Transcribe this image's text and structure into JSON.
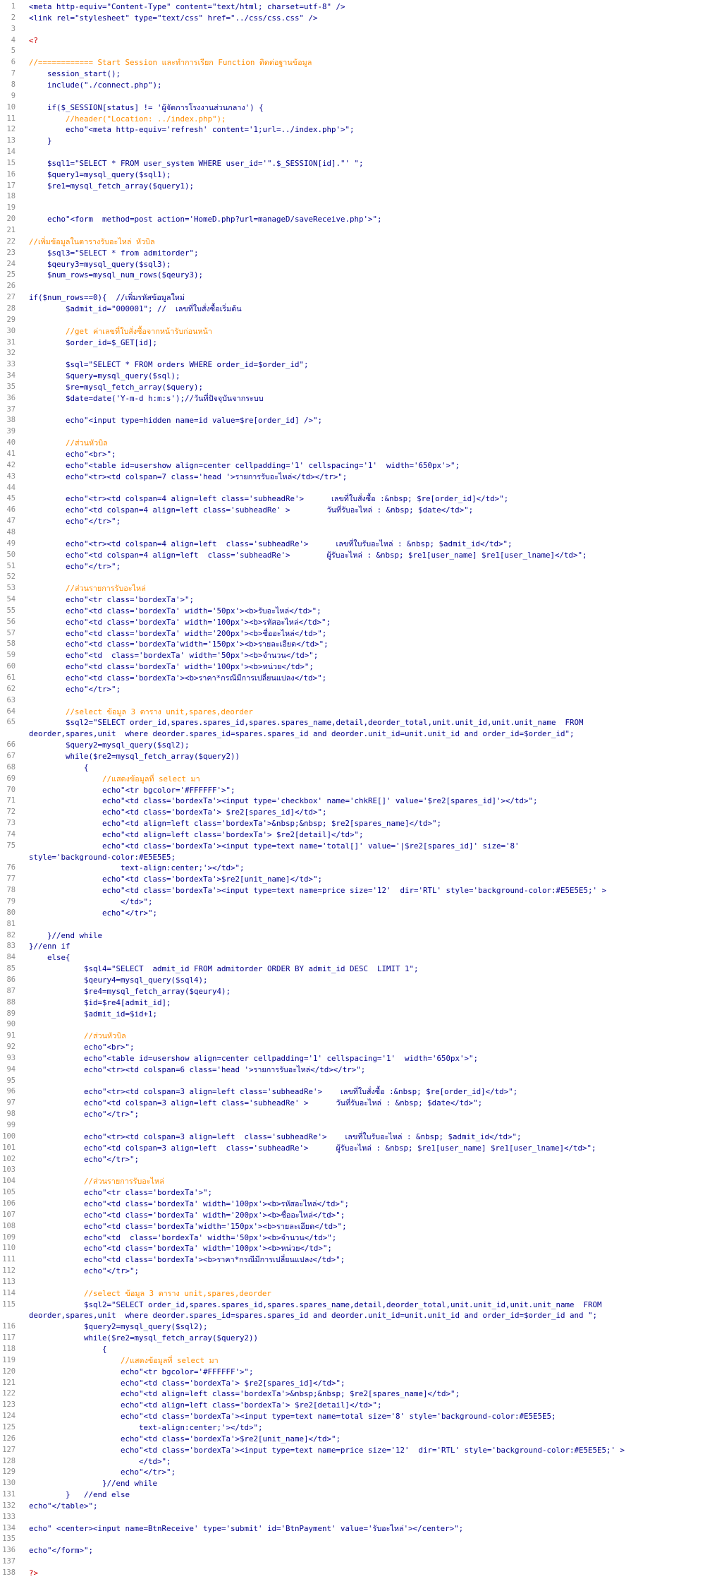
{
  "colors": {
    "keyword": "#00008b",
    "string": "#cc0000",
    "comment": "#ff8c00",
    "linenumber": "#8c8c8c"
  },
  "lines": [
    {
      "n": "1",
      "code": "<meta http-equiv=\"Content-Type\" content=\"text/html; charset=utf-8\" />",
      "type": "kw"
    },
    {
      "n": "2",
      "code": "<link rel=\"stylesheet\" type=\"text/css\" href=\"../css/css.css\" />",
      "type": "kw"
    },
    {
      "n": "3",
      "code": "",
      "type": "kw"
    },
    {
      "n": "4",
      "code": "<?",
      "type": "str"
    },
    {
      "n": "5",
      "code": "",
      "type": "kw"
    },
    {
      "n": "6",
      "code": "//============ Start Session และทำการเรียก Function ติดต่อฐานข้อมูล",
      "type": "cmt"
    },
    {
      "n": "7",
      "code": "    session_start();",
      "type": "kw"
    },
    {
      "n": "8",
      "code": "    include(\"./connect.php\");",
      "type": "kw"
    },
    {
      "n": "9",
      "code": "",
      "type": "kw"
    },
    {
      "n": "10",
      "code": "    if($_SESSION[status] != 'ผู้จัดการโรงงานส่วนกลาง') {",
      "type": "kw"
    },
    {
      "n": "11",
      "code": "        //header(\"Location: ../index.php\");",
      "type": "cmt"
    },
    {
      "n": "12",
      "code": "        echo\"<meta http-equiv='refresh' content='1;url=../index.php'>\";",
      "type": "kw"
    },
    {
      "n": "13",
      "code": "    }",
      "type": "kw"
    },
    {
      "n": "14",
      "code": "",
      "type": "kw"
    },
    {
      "n": "15",
      "code": "    $sql1=\"SELECT * FROM user_system WHERE user_id='\".$_SESSION[id].\"' \";",
      "type": "kw"
    },
    {
      "n": "16",
      "code": "    $query1=mysql_query($sql1);",
      "type": "kw"
    },
    {
      "n": "17",
      "code": "    $re1=mysql_fetch_array($query1);",
      "type": "kw"
    },
    {
      "n": "18",
      "code": "",
      "type": "kw"
    },
    {
      "n": "19",
      "code": "",
      "type": "kw"
    },
    {
      "n": "20",
      "code": "    echo\"<form  method=post action='HomeD.php?url=manageD/saveReceive.php'>\";",
      "type": "kw"
    },
    {
      "n": "21",
      "code": "",
      "type": "kw"
    },
    {
      "n": "22",
      "code": "//เพิ่มข้อมูลในตารางรับอะไหล่ หัวบิล",
      "type": "cmt"
    },
    {
      "n": "23",
      "code": "    $sql3=\"SELECT * from admitorder\";",
      "type": "kw"
    },
    {
      "n": "24",
      "code": "    $qeury3=mysql_query($sql3);",
      "type": "kw"
    },
    {
      "n": "25",
      "code": "    $num_rows=mysql_num_rows($qeury3);",
      "type": "kw"
    },
    {
      "n": "26",
      "code": "",
      "type": "kw"
    },
    {
      "n": "27",
      "code": "if($num_rows==0){  //เพิ่มรหัสข้อมูลใหม่",
      "type": "kw"
    },
    {
      "n": "28",
      "code": "        $admit_id=\"000001\"; //  เลขที่ใบสั่งซื้อเริ่มต้น",
      "type": "kw"
    },
    {
      "n": "29",
      "code": "",
      "type": "kw"
    },
    {
      "n": "30",
      "code": "        //get ค่าเลขที่ใบสั่งซื้อจากหน้ารับก่อนหน้า",
      "type": "cmt"
    },
    {
      "n": "31",
      "code": "        $order_id=$_GET[id];",
      "type": "kw"
    },
    {
      "n": "32",
      "code": "",
      "type": "kw"
    },
    {
      "n": "33",
      "code": "        $sql=\"SELECT * FROM orders WHERE order_id=$order_id\";",
      "type": "kw"
    },
    {
      "n": "34",
      "code": "        $query=mysql_query($sql);",
      "type": "kw"
    },
    {
      "n": "35",
      "code": "        $re=mysql_fetch_array($query);",
      "type": "kw"
    },
    {
      "n": "36",
      "code": "        $date=date('Y-m-d h:m:s');//วันที่ปัจจุบันจากระบบ",
      "type": "kw"
    },
    {
      "n": "37",
      "code": "",
      "type": "kw"
    },
    {
      "n": "38",
      "code": "        echo\"<input type=hidden name=id value=$re[order_id] />\";",
      "type": "kw"
    },
    {
      "n": "39",
      "code": "",
      "type": "kw"
    },
    {
      "n": "40",
      "code": "        //ส่วนหัวบิล",
      "type": "cmt"
    },
    {
      "n": "41",
      "code": "        echo\"<br>\";",
      "type": "kw"
    },
    {
      "n": "42",
      "code": "        echo\"<table id=usershow align=center cellpadding='1' cellspacing='1'  width='650px'>\";",
      "type": "kw"
    },
    {
      "n": "43",
      "code": "        echo\"<tr><td colspan=7 class='head '>รายการรับอะไหล่</td></tr>\";",
      "type": "kw"
    },
    {
      "n": "44",
      "code": "",
      "type": "kw"
    },
    {
      "n": "45",
      "code": "        echo\"<tr><td colspan=4 align=left class='subheadRe'>      เลขที่ใบสั่งซื้อ :&nbsp; $re[order_id]</td>\";",
      "type": "kw"
    },
    {
      "n": "46",
      "code": "        echo\"<td colspan=4 align=left class='subheadRe' >        วันที่รับอะไหล่ : &nbsp; $date</td>\";",
      "type": "kw"
    },
    {
      "n": "47",
      "code": "        echo\"</tr>\";",
      "type": "kw"
    },
    {
      "n": "48",
      "code": "",
      "type": "kw"
    },
    {
      "n": "49",
      "code": "        echo\"<tr><td colspan=4 align=left  class='subheadRe'>      เลขที่ใบรับอะไหล่ : &nbsp; $admit_id</td>\";",
      "type": "kw"
    },
    {
      "n": "50",
      "code": "        echo\"<td colspan=4 align=left  class='subheadRe'>        ผู้รับอะไหล่ : &nbsp; $re1[user_name] $re1[user_lname]</td>\";",
      "type": "kw"
    },
    {
      "n": "51",
      "code": "        echo\"</tr>\";",
      "type": "kw"
    },
    {
      "n": "52",
      "code": "",
      "type": "kw"
    },
    {
      "n": "53",
      "code": "        //ส่วนรายการรับอะไหล่",
      "type": "cmt"
    },
    {
      "n": "54",
      "code": "        echo\"<tr class='bordexTa'>\";",
      "type": "kw"
    },
    {
      "n": "55",
      "code": "        echo\"<td class='bordexTa' width='50px'><b>รับอะไหล่</td>\";",
      "type": "kw"
    },
    {
      "n": "56",
      "code": "        echo\"<td class='bordexTa' width='100px'><b>รหัสอะไหล่</td>\";",
      "type": "kw"
    },
    {
      "n": "57",
      "code": "        echo\"<td class='bordexTa' width='200px'><b>ชื่ออะไหล่</td>\";",
      "type": "kw"
    },
    {
      "n": "58",
      "code": "        echo\"<td class='bordexTa'width='150px'><b>รายละเอียด</td>\";",
      "type": "kw"
    },
    {
      "n": "59",
      "code": "        echo\"<td  class='bordexTa' width='50px'><b>จำนวน</td>\";",
      "type": "kw"
    },
    {
      "n": "60",
      "code": "        echo\"<td class='bordexTa' width='100px'><b>หน่วย</td>\";",
      "type": "kw"
    },
    {
      "n": "61",
      "code": "        echo\"<td class='bordexTa'><b>ราคา*กรณีมีการเปลี่ยนแปลง</td>\";",
      "type": "kw"
    },
    {
      "n": "62",
      "code": "        echo\"</tr>\";",
      "type": "kw"
    },
    {
      "n": "63",
      "code": "",
      "type": "kw"
    },
    {
      "n": "64",
      "code": "        //select ข้อมูล 3 ตาราง unit,spares,deorder",
      "type": "cmt"
    },
    {
      "n": "65",
      "code": "        $sql2=\"SELECT order_id,spares.spares_id,spares.spares_name,detail,deorder_total,unit.unit_id,unit.unit_name  FROM",
      "type": "kw"
    },
    {
      "n": "",
      "code": "deorder,spares,unit  where deorder.spares_id=spares.spares_id and deorder.unit_id=unit.unit_id and order_id=$order_id\";",
      "type": "kw"
    },
    {
      "n": "66",
      "code": "        $query2=mysql_query($sql2);",
      "type": "kw"
    },
    {
      "n": "67",
      "code": "        while($re2=mysql_fetch_array($query2))",
      "type": "kw"
    },
    {
      "n": "68",
      "code": "            {",
      "type": "kw"
    },
    {
      "n": "69",
      "code": "                //แสดงข้อมูลที่ select มา",
      "type": "cmt"
    },
    {
      "n": "70",
      "code": "                echo\"<tr bgcolor='#FFFFFF'>\";",
      "type": "kw"
    },
    {
      "n": "71",
      "code": "                echo\"<td class='bordexTa'><input type='checkbox' name='chkRE[]' value='$re2[spares_id]'></td>\";",
      "type": "kw"
    },
    {
      "n": "72",
      "code": "                echo\"<td class='bordexTa'> $re2[spares_id]</td>\";",
      "type": "kw"
    },
    {
      "n": "73",
      "code": "                echo\"<td align=left class='bordexTa'>&nbsp;&nbsp; $re2[spares_name]</td>\";",
      "type": "kw"
    },
    {
      "n": "74",
      "code": "                echo\"<td align=left class='bordexTa'> $re2[detail]</td>\";",
      "type": "kw"
    },
    {
      "n": "75",
      "code": "                echo\"<td class='bordexTa'><input type=text name='total[]' value='|$re2[spares_id]' size='8'",
      "type": "kw"
    },
    {
      "n": "",
      "code": "style='background-color:#E5E5E5;",
      "type": "kw"
    },
    {
      "n": "76",
      "code": "                    text-align:center;'></td>\";",
      "type": "kw"
    },
    {
      "n": "77",
      "code": "                echo\"<td class='bordexTa'>$re2[unit_name]</td>\";",
      "type": "kw"
    },
    {
      "n": "78",
      "code": "                echo\"<td class='bordexTa'><input type=text name=price size='12'  dir='RTL' style='background-color:#E5E5E5;' >",
      "type": "kw"
    },
    {
      "n": "79",
      "code": "                    </td>\";",
      "type": "kw"
    },
    {
      "n": "80",
      "code": "                echo\"</tr>\";",
      "type": "kw"
    },
    {
      "n": "81",
      "code": "",
      "type": "kw"
    },
    {
      "n": "82",
      "code": "    }//end while",
      "type": "kw"
    },
    {
      "n": "83",
      "code": "}//enn if",
      "type": "kw"
    },
    {
      "n": "84",
      "code": "    else{",
      "type": "kw"
    },
    {
      "n": "85",
      "code": "            $sql4=\"SELECT  admit_id FROM admitorder ORDER BY admit_id DESC  LIMIT 1\";",
      "type": "kw"
    },
    {
      "n": "86",
      "code": "            $qeury4=mysql_query($sql4);",
      "type": "kw"
    },
    {
      "n": "87",
      "code": "            $re4=mysql_fetch_array($qeury4);",
      "type": "kw"
    },
    {
      "n": "88",
      "code": "            $id=$re4[admit_id];",
      "type": "kw"
    },
    {
      "n": "89",
      "code": "            $admit_id=$id+1;",
      "type": "kw"
    },
    {
      "n": "90",
      "code": "",
      "type": "kw"
    },
    {
      "n": "91",
      "code": "            //ส่วนหัวบิล",
      "type": "cmt"
    },
    {
      "n": "92",
      "code": "            echo\"<br>\";",
      "type": "kw"
    },
    {
      "n": "93",
      "code": "            echo\"<table id=usershow align=center cellpadding='1' cellspacing='1'  width='650px'>\";",
      "type": "kw"
    },
    {
      "n": "94",
      "code": "            echo\"<tr><td colspan=6 class='head '>รายการรับอะไหล่</td></tr>\";",
      "type": "kw"
    },
    {
      "n": "95",
      "code": "",
      "type": "kw"
    },
    {
      "n": "96",
      "code": "            echo\"<tr><td colspan=3 align=left class='subheadRe'>    เลขที่ใบสั่งซื้อ :&nbsp; $re[order_id]</td>\";",
      "type": "kw"
    },
    {
      "n": "97",
      "code": "            echo\"<td colspan=3 align=left class='subheadRe' >      วันที่รับอะไหล่ : &nbsp; $date</td>\";",
      "type": "kw"
    },
    {
      "n": "98",
      "code": "            echo\"</tr>\";",
      "type": "kw"
    },
    {
      "n": "99",
      "code": "",
      "type": "kw"
    },
    {
      "n": "100",
      "code": "            echo\"<tr><td colspan=3 align=left  class='subheadRe'>    เลขที่ใบรับอะไหล่ : &nbsp; $admit_id</td>\";",
      "type": "kw"
    },
    {
      "n": "101",
      "code": "            echo\"<td colspan=3 align=left  class='subheadRe'>      ผู้รับอะไหล่ : &nbsp; $re1[user_name] $re1[user_lname]</td>\";",
      "type": "kw"
    },
    {
      "n": "102",
      "code": "            echo\"</tr>\";",
      "type": "kw"
    },
    {
      "n": "103",
      "code": "",
      "type": "kw"
    },
    {
      "n": "104",
      "code": "            //ส่วนรายการรับอะไหล่",
      "type": "cmt"
    },
    {
      "n": "105",
      "code": "            echo\"<tr class='bordexTa'>\";",
      "type": "kw"
    },
    {
      "n": "106",
      "code": "            echo\"<td class='bordexTa' width='100px'><b>รหัสอะไหล่</td>\";",
      "type": "kw"
    },
    {
      "n": "107",
      "code": "            echo\"<td class='bordexTa' width='200px'><b>ชื่ออะไหล่</td>\";",
      "type": "kw"
    },
    {
      "n": "108",
      "code": "            echo\"<td class='bordexTa'width='150px'><b>รายละเอียด</td>\";",
      "type": "kw"
    },
    {
      "n": "109",
      "code": "            echo\"<td  class='bordexTa' width='50px'><b>จำนวน</td>\";",
      "type": "kw"
    },
    {
      "n": "110",
      "code": "            echo\"<td class='bordexTa' width='100px'><b>หน่วย</td>\";",
      "type": "kw"
    },
    {
      "n": "111",
      "code": "            echo\"<td class='bordexTa'><b>ราคา*กรณีมีการเปลี่ยนแปลง</td>\";",
      "type": "kw"
    },
    {
      "n": "112",
      "code": "            echo\"</tr>\";",
      "type": "kw"
    },
    {
      "n": "113",
      "code": "",
      "type": "kw"
    },
    {
      "n": "114",
      "code": "            //select ข้อมูล 3 ตาราง unit,spares,deorder",
      "type": "cmt"
    },
    {
      "n": "115",
      "code": "            $sql2=\"SELECT order_id,spares.spares_id,spares.spares_name,detail,deorder_total,unit.unit_id,unit.unit_name  FROM",
      "type": "kw"
    },
    {
      "n": "",
      "code": "deorder,spares,unit  where deorder.spares_id=spares.spares_id and deorder.unit_id=unit.unit_id and order_id=$order_id and \";",
      "type": "kw"
    },
    {
      "n": "116",
      "code": "            $query2=mysql_query($sql2);",
      "type": "kw"
    },
    {
      "n": "117",
      "code": "            while($re2=mysql_fetch_array($query2))",
      "type": "kw"
    },
    {
      "n": "118",
      "code": "                {",
      "type": "kw"
    },
    {
      "n": "119",
      "code": "                    //แสดงข้อมูลที่ select มา",
      "type": "cmt"
    },
    {
      "n": "120",
      "code": "                    echo\"<tr bgcolor='#FFFFFF'>\";",
      "type": "kw"
    },
    {
      "n": "121",
      "code": "                    echo\"<td class='bordexTa'> $re2[spares_id]</td>\";",
      "type": "kw"
    },
    {
      "n": "122",
      "code": "                    echo\"<td align=left class='bordexTa'>&nbsp;&nbsp; $re2[spares_name]</td>\";",
      "type": "kw"
    },
    {
      "n": "123",
      "code": "                    echo\"<td align=left class='bordexTa'> $re2[detail]</td>\";",
      "type": "kw"
    },
    {
      "n": "124",
      "code": "                    echo\"<td class='bordexTa'><input type=text name=total size='8' style='background-color:#E5E5E5;",
      "type": "kw"
    },
    {
      "n": "125",
      "code": "                        text-align:center;'></td>\";",
      "type": "kw"
    },
    {
      "n": "126",
      "code": "                    echo\"<td class='bordexTa'>$re2[unit_name]</td>\";",
      "type": "kw"
    },
    {
      "n": "127",
      "code": "                    echo\"<td class='bordexTa'><input type=text name=price size='12'  dir='RTL' style='background-color:#E5E5E5;' >",
      "type": "kw"
    },
    {
      "n": "128",
      "code": "                        </td>\";",
      "type": "kw"
    },
    {
      "n": "129",
      "code": "                    echo\"</tr>\";",
      "type": "kw"
    },
    {
      "n": "130",
      "code": "                }//end while",
      "type": "kw"
    },
    {
      "n": "131",
      "code": "        }   //end else",
      "type": "kw"
    },
    {
      "n": "132",
      "code": "echo\"</table>\";",
      "type": "kw"
    },
    {
      "n": "133",
      "code": "",
      "type": "kw"
    },
    {
      "n": "134",
      "code": "echo\" <center><input name=BtnReceive' type='submit' id='BtnPayment' value='รับอะไหล่'></center>\";",
      "type": "kw"
    },
    {
      "n": "135",
      "code": "",
      "type": "kw"
    },
    {
      "n": "136",
      "code": "echo\"</form>\";",
      "type": "kw"
    },
    {
      "n": "137",
      "code": "",
      "type": "kw"
    },
    {
      "n": "138",
      "code": "?>",
      "type": "str"
    }
  ]
}
